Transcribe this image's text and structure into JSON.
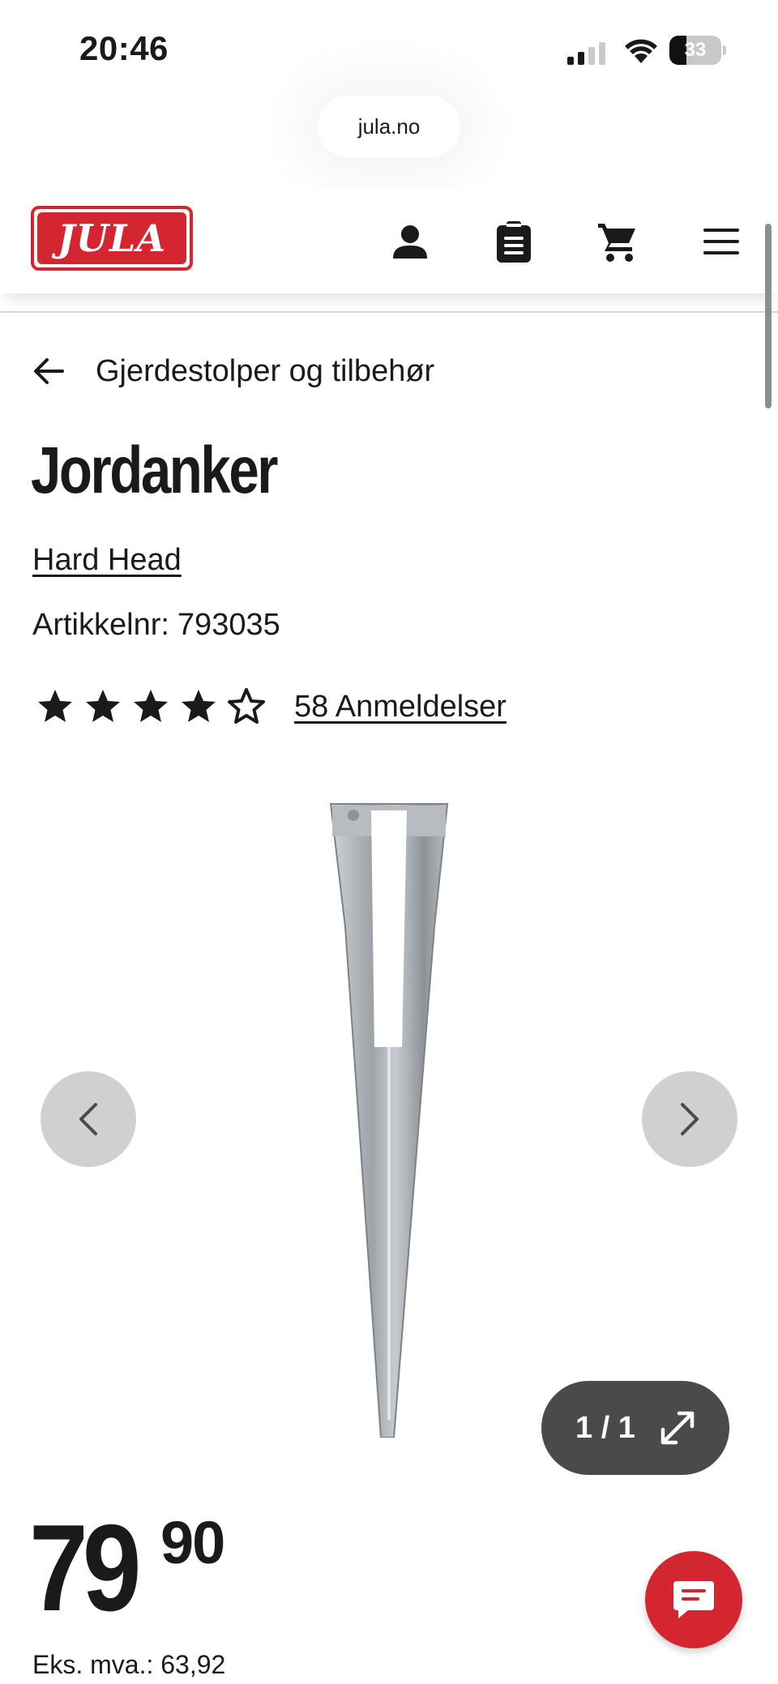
{
  "status_bar": {
    "time": "20:46",
    "battery_level": "33",
    "battery_fraction": 0.33
  },
  "browser": {
    "url": "jula.no"
  },
  "header": {
    "logo_text": "JULA",
    "brand_color": "#d32630",
    "icons": [
      "user-icon",
      "shopping-list-icon",
      "cart-icon",
      "menu-icon"
    ]
  },
  "breadcrumb": {
    "label": "Gjerdestolper og tilbehør"
  },
  "product": {
    "title": "Jordanker",
    "brand": "Hard Head",
    "article_label": "Artikkelnr:",
    "article_number": "793035",
    "rating": 4.5,
    "rating_max": 5,
    "reviews_label": "58 Anmeldelser",
    "image_counter": "1 / 1",
    "price_integer": "79",
    "price_decimal": "90",
    "ex_vat_label": "Eks. mva.: 63,92"
  },
  "colors": {
    "accent": "#d32630",
    "text": "#1a1a1a",
    "nav_button": "#d0d0d0",
    "counter_pill": "#4a4a4a"
  }
}
